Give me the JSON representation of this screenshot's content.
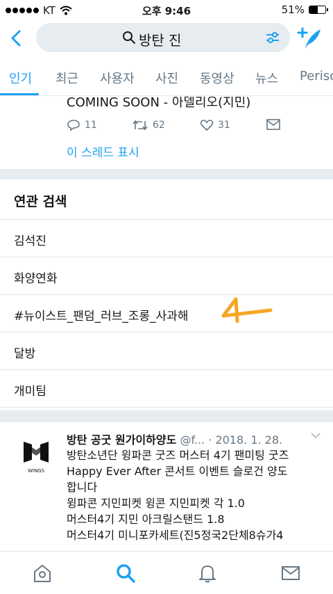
{
  "status": {
    "carrier": "KT",
    "time": "오후 9:46",
    "battery": "51%",
    "battery_level": 0.51
  },
  "search": {
    "query": "방탄 진"
  },
  "tabs": [
    {
      "label": "인기",
      "active": true
    },
    {
      "label": "최근"
    },
    {
      "label": "사용자"
    },
    {
      "label": "사진"
    },
    {
      "label": "동영상"
    },
    {
      "label": "뉴스"
    },
    {
      "label": "Perisc"
    }
  ],
  "top_tweet": {
    "text": "COMING SOON - 아델리오(지민)",
    "replies": "11",
    "retweets": "62",
    "likes": "31",
    "thread_link": "이 스레드 표시"
  },
  "related": {
    "title": "연관 검색",
    "items": [
      "김석진",
      "화양연화",
      "#뉴이스트_팬덤_러브_조롱_사과해",
      "달방",
      "개미팀"
    ]
  },
  "tweet2": {
    "name": "방탄 공굿 원가이하양도",
    "handle": "@f...",
    "date": "· 2018. 1. 28.",
    "avatar_caption": "WINGS",
    "lines": [
      "방탄소년단 윙파콘 굿즈 머스터 4기 팬미팅 굿즈",
      "Happy Ever After 콘서트 이벤트 슬로건 양도",
      "합니다",
      "윙파콘 지민피켓 윙콘 지민피켓 각 1.0",
      "머스터4기 지민 아크릴스탠드 1.8",
      "머스터4기 미니포카세트(진5정국2단체8슈가4"
    ]
  },
  "colors": {
    "accent": "#1da1f2",
    "muted": "#657786",
    "annotation": "#f5a623"
  }
}
